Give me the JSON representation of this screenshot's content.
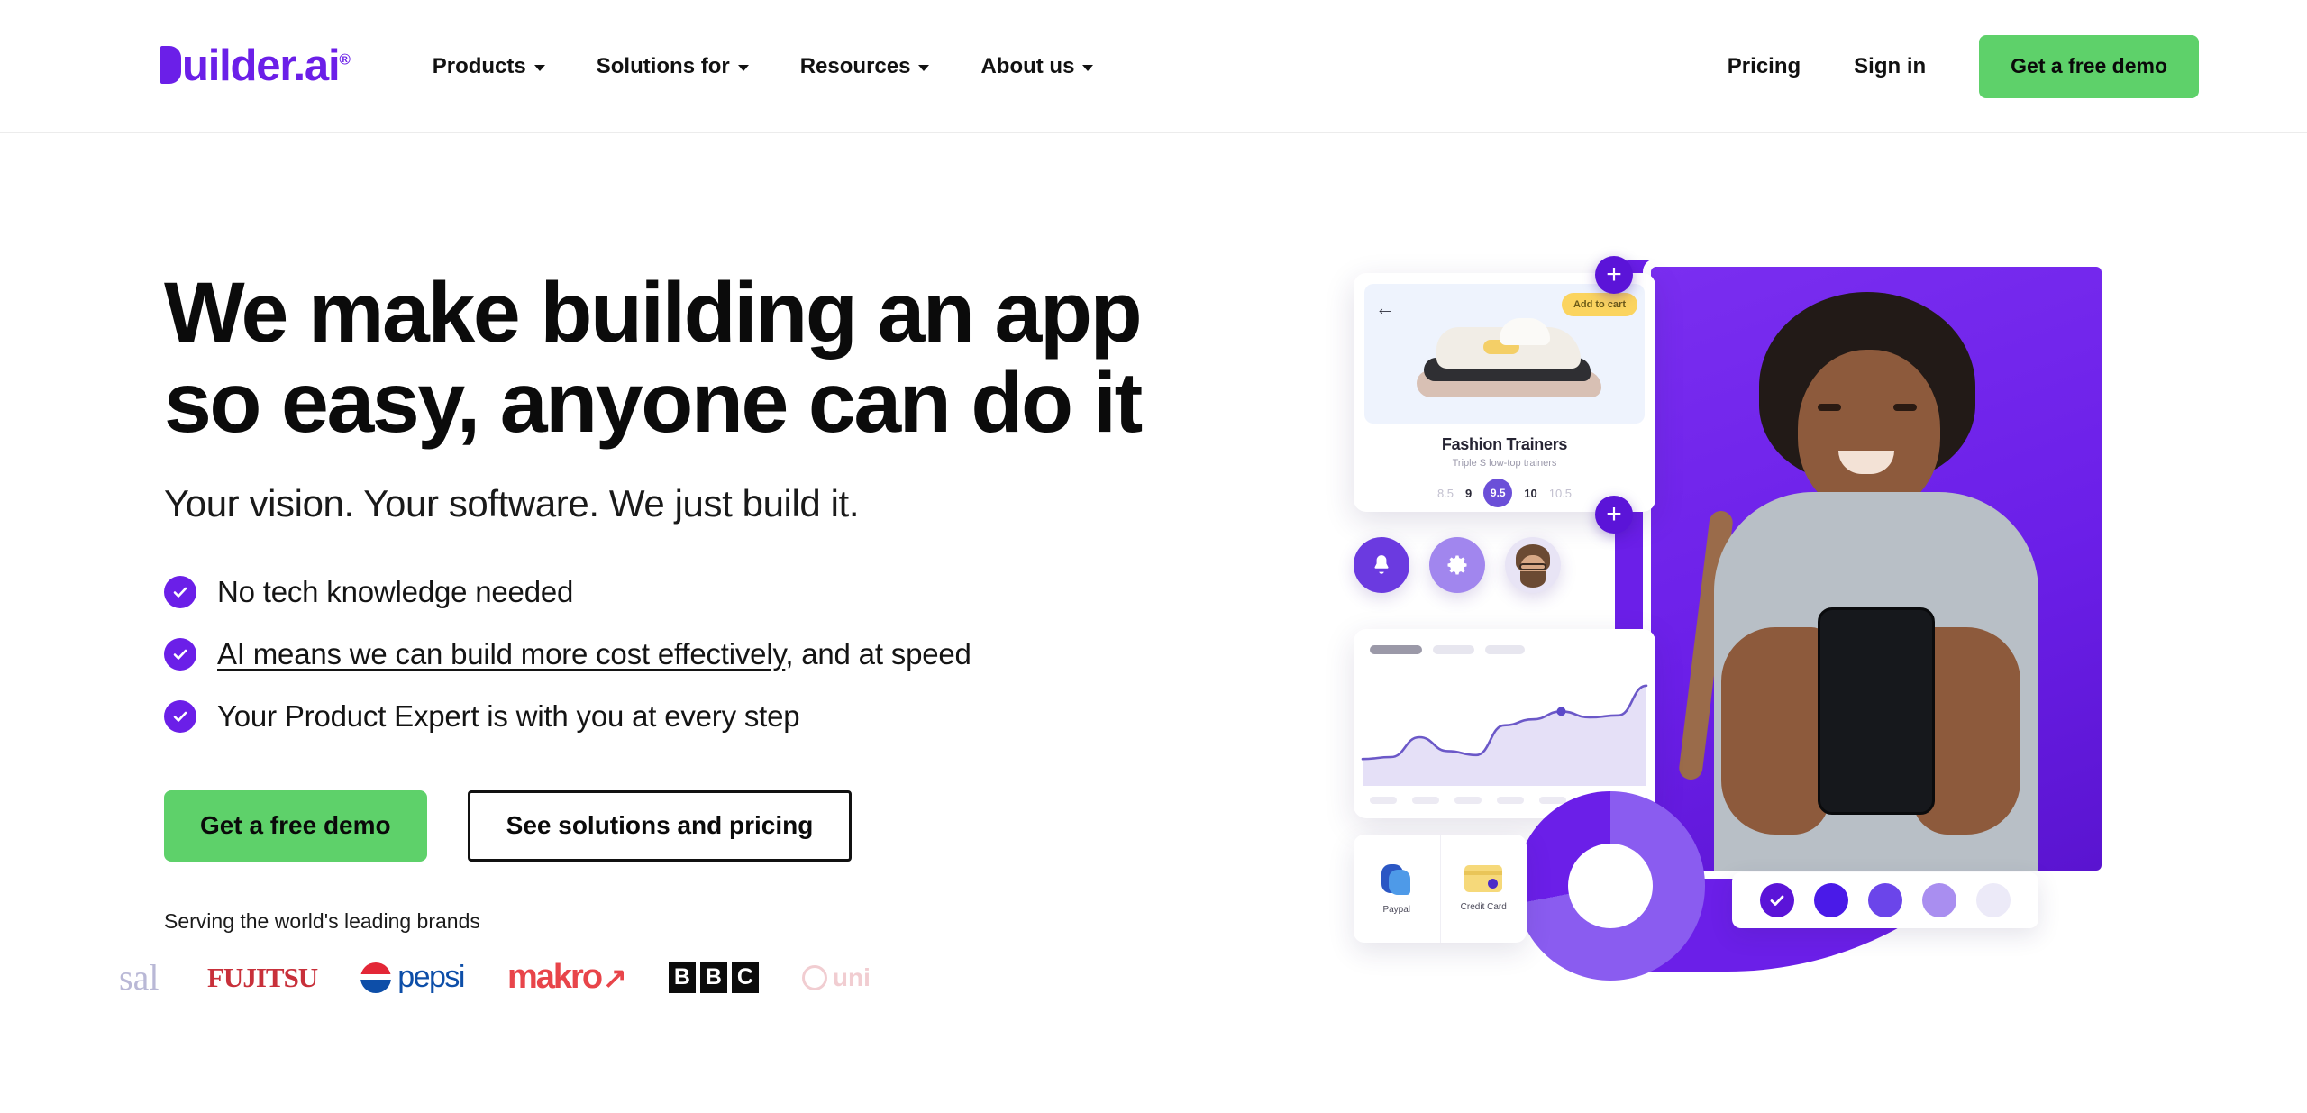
{
  "header": {
    "logo": {
      "text": "uilder.ai",
      "mark": "B",
      "registered": "®"
    },
    "nav": [
      {
        "label": "Products",
        "icon": "chevron-down-icon"
      },
      {
        "label": "Solutions for",
        "icon": "chevron-down-icon"
      },
      {
        "label": "Resources",
        "icon": "chevron-down-icon"
      },
      {
        "label": "About us",
        "icon": "chevron-down-icon"
      }
    ],
    "pricing_label": "Pricing",
    "signin_label": "Sign in",
    "demo_label": "Get a free demo"
  },
  "hero": {
    "headline_line1": "We make building an app",
    "headline_line2": "so easy, anyone can do it",
    "subhead": "Your vision. Your software. We just build it.",
    "bullets": [
      {
        "icon": "check-circle-icon",
        "text": "No tech knowledge needed",
        "link_text": "",
        "tail": ""
      },
      {
        "icon": "check-circle-icon",
        "text": "",
        "link_text": "AI means we can build more cost effectively",
        "tail": ", and at speed"
      },
      {
        "icon": "check-circle-icon",
        "text": "Your Product Expert is with you at every step",
        "link_text": "",
        "tail": ""
      }
    ],
    "primary_cta": "Get a free demo",
    "secondary_cta": "See solutions and pricing",
    "brands_label": "Serving the world's leading brands",
    "brands": [
      {
        "name": "sal",
        "label": "sal"
      },
      {
        "name": "fujitsu",
        "label": "FUJITSU"
      },
      {
        "name": "pepsi",
        "label": "pepsi"
      },
      {
        "name": "makro",
        "label": "makro",
        "arrow": "↗"
      },
      {
        "name": "bbc",
        "letters": [
          "B",
          "B",
          "C"
        ]
      },
      {
        "name": "uni",
        "label": "uni"
      }
    ]
  },
  "art": {
    "product_card": {
      "back_icon": "back-arrow-icon",
      "add_to_cart": "Add to cart",
      "title": "Fashion Trainers",
      "subtitle": "Triple S low-top trainers",
      "sizes": [
        "8.5",
        "9",
        "9.5",
        "10",
        "10.5"
      ],
      "selected_size": "9.5"
    },
    "plus_badge": "+",
    "icons": [
      {
        "name": "bell-icon",
        "glyph": "bell"
      },
      {
        "name": "gear-icon",
        "glyph": "gear"
      },
      {
        "name": "avatar",
        "glyph": "avatar"
      }
    ],
    "payment": [
      {
        "name": "paypal-option",
        "label": "Paypal"
      },
      {
        "name": "credit-card-option",
        "label": "Credit Card"
      }
    ],
    "swatches": [
      "#5b14d8",
      "#4a1ae8",
      "#6b45ea",
      "#a98ef0",
      "#eceaf8"
    ],
    "selected_swatch_index": 0
  },
  "colors": {
    "brand_purple": "#6b1fe8",
    "cta_green": "#5ed16a",
    "text_black": "#0b0b0b",
    "accent_yellow": "#fbd45f"
  },
  "chart_data": {
    "type": "area",
    "title": "",
    "x": [
      0,
      1,
      2,
      3,
      4,
      5,
      6,
      7,
      8,
      9,
      10
    ],
    "values": [
      18,
      20,
      40,
      26,
      22,
      52,
      58,
      66,
      60,
      62,
      92
    ],
    "ylim": [
      0,
      100
    ],
    "grid": false,
    "legend": "none",
    "highlight_index": 7,
    "line_color": "#6b58c8",
    "fill_color": "#e5e0f7"
  }
}
